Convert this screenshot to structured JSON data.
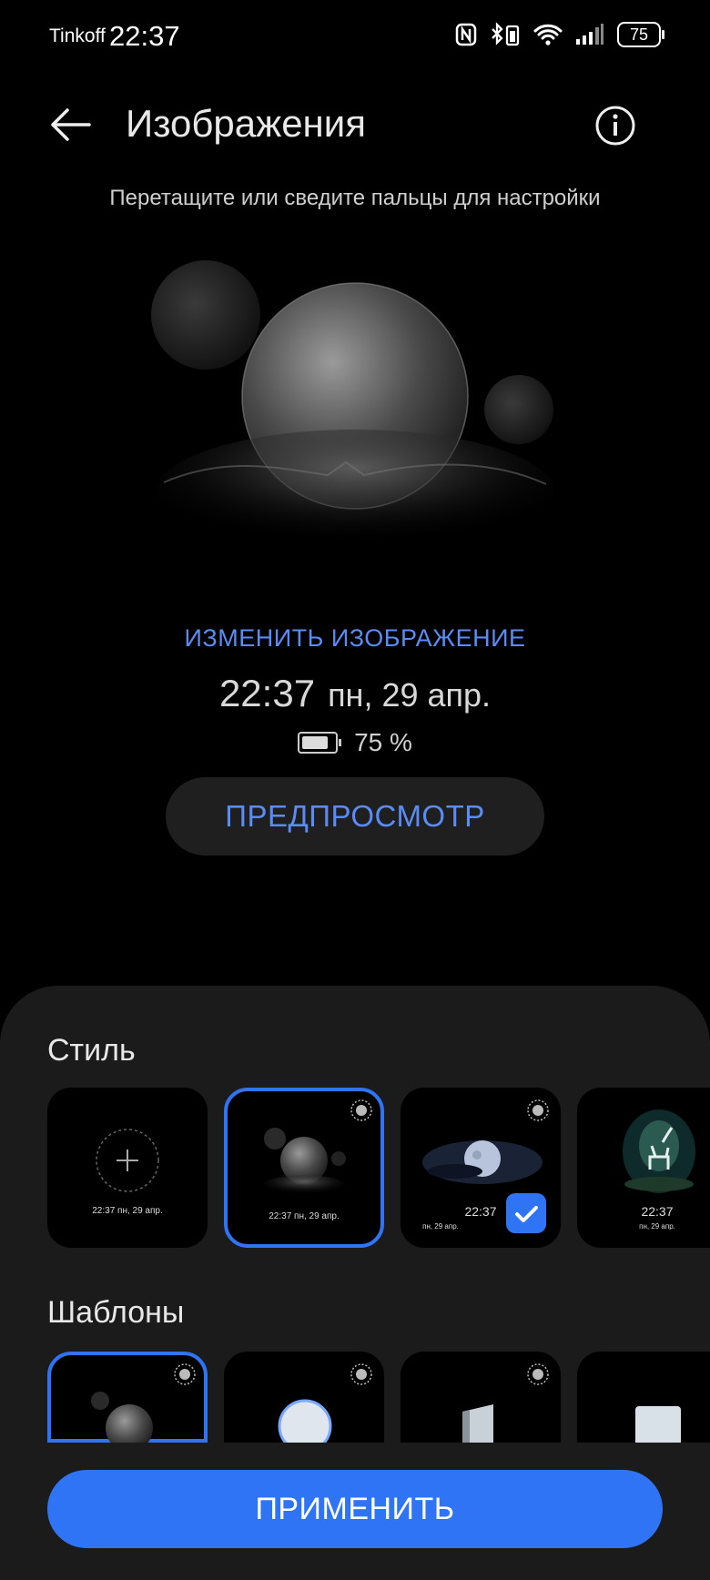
{
  "status": {
    "carrier": "Tinkoff",
    "time": "22:37",
    "battery": "75"
  },
  "header": {
    "title": "Изображения"
  },
  "hint": "Перетащите или сведите пальцы для настройки",
  "preview": {
    "change_label": "ИЗМЕНИТЬ ИЗОБРАЖЕНИЕ",
    "time": "22:37",
    "date": "пн, 29 апр.",
    "battery_text": "75 %",
    "preview_button": "ПРЕДПРОСМОТР"
  },
  "styles": {
    "title": "Стиль",
    "cards": [
      {
        "time_line": "22:37 пн, 29 апр."
      },
      {
        "time_line": "22:37 пн, 29 апр."
      },
      {
        "time": "22:37",
        "date": "пн, 29 апр."
      },
      {
        "time": "22:37",
        "date": "пн, 29 апр."
      }
    ]
  },
  "templates": {
    "title": "Шаблоны"
  },
  "apply_button": "ПРИМЕНИТЬ",
  "colors": {
    "accent": "#2f74f5",
    "link": "#5b8cf5",
    "sheet": "#1b1b1b"
  }
}
